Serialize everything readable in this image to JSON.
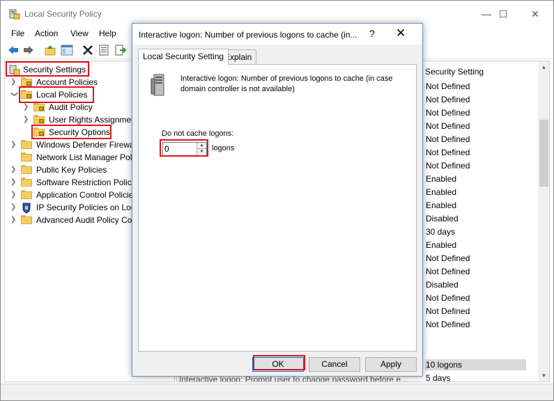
{
  "window": {
    "title": "Local Security Policy",
    "minimize_glyph": "—",
    "maximize_glyph": "☐",
    "close_glyph": "✕"
  },
  "menu": [
    "File",
    "Action",
    "View",
    "Help"
  ],
  "toolbar_icons": [
    "back-arrow-icon",
    "forward-arrow-icon",
    "up-folder-icon",
    "show-hide-tree-icon",
    "delete-icon",
    "properties-icon",
    "export-list-icon"
  ],
  "tree": {
    "root": "Security Settings",
    "account_policies": "Account Policies",
    "local_policies": "Local Policies",
    "audit_policy": "Audit Policy",
    "user_rights": "User Rights Assignmen",
    "security_options": "Security Options",
    "defender_firewall": "Windows Defender Firewal",
    "network_list": "Network List Manager Poli",
    "public_key": "Public Key Policies",
    "software_restriction": "Software Restriction Polici",
    "app_control": "Application Control Policie",
    "ip_security": "IP Security Policies on Loca",
    "advanced_audit": "Advanced Audit Policy Co"
  },
  "list": {
    "column_header": "Security Setting",
    "values": [
      "Not Defined",
      "Not Defined",
      "Not Defined",
      "Not Defined",
      "Not Defined",
      "Not Defined",
      "Not Defined",
      "Enabled",
      "Enabled",
      "Enabled",
      "Disabled",
      "30 days",
      "Enabled",
      "Not Defined",
      "Not Defined",
      "Disabled",
      "Not Defined",
      "Not Defined",
      "Not Defined"
    ],
    "highlighted_value": "10 logons",
    "last_value": "5 days",
    "bottom_policy_text": "Interactive logon: Prompt user to change password before e..."
  },
  "dialog": {
    "title": "Interactive logon: Number of previous logons to cache (in...",
    "help_glyph": "?",
    "close_glyph": "✕",
    "tabs": [
      "Local Security Setting",
      "Explain"
    ],
    "description": "Interactive logon: Number of previous logons to cache (in case domain controller is not available)",
    "cache_label": "Do not cache logons:",
    "cache_value": "0",
    "logons_label": "logons",
    "ok": "OK",
    "cancel": "Cancel",
    "apply": "Apply"
  },
  "colors": {
    "annotation": "#e0121d",
    "folder": "#f4cf5f",
    "dialog_bg": "#f0f0f0",
    "accent": "#0078d7"
  }
}
